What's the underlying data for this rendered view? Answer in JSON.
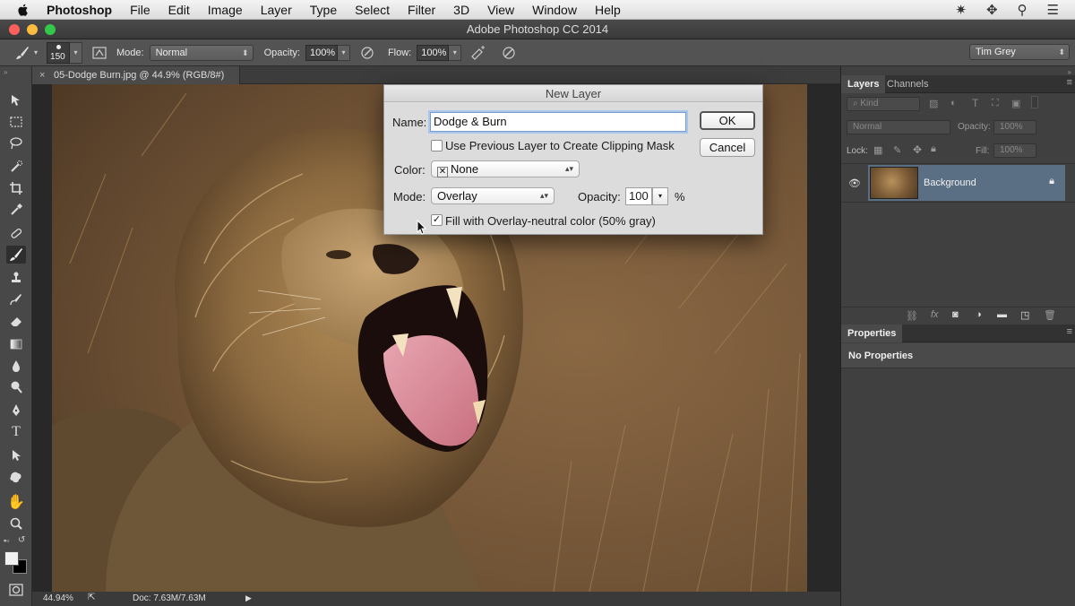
{
  "menubar": {
    "app_name": "Photoshop",
    "items": [
      "File",
      "Edit",
      "Image",
      "Layer",
      "Type",
      "Select",
      "Filter",
      "3D",
      "View",
      "Window",
      "Help"
    ]
  },
  "window": {
    "title": "Adobe Photoshop CC 2014"
  },
  "options_bar": {
    "brush_size": "150",
    "mode_label": "Mode:",
    "mode_value": "Normal",
    "opacity_label": "Opacity:",
    "opacity_value": "100%",
    "flow_label": "Flow:",
    "flow_value": "100%",
    "workspace": "Tim Grey"
  },
  "document": {
    "tab_title": "05-Dodge Burn.jpg @ 44.9% (RGB/8#)",
    "zoom": "44.94%",
    "doc_size": "Doc: 7.63M/7.63M"
  },
  "layers_panel": {
    "tabs": [
      "Layers",
      "Channels"
    ],
    "filter_kind": "Kind",
    "blend_mode": "Normal",
    "opacity_label": "Opacity:",
    "opacity_value": "100%",
    "lock_label": "Lock:",
    "fill_label": "Fill:",
    "fill_value": "100%",
    "layers": [
      {
        "name": "Background",
        "locked": true,
        "visible": true
      }
    ]
  },
  "properties_panel": {
    "tab": "Properties",
    "message": "No Properties"
  },
  "dialog": {
    "title": "New Layer",
    "name_label": "Name:",
    "name_value": "Dodge & Burn",
    "clipping_label": "Use Previous Layer to Create Clipping Mask",
    "clipping_checked": false,
    "color_label": "Color:",
    "color_value": "None",
    "mode_label": "Mode:",
    "mode_value": "Overlay",
    "opacity_label": "Opacity:",
    "opacity_value": "100",
    "opacity_unit": "%",
    "fill_neutral_label": "Fill with Overlay-neutral color (50% gray)",
    "fill_neutral_checked": true,
    "ok_label": "OK",
    "cancel_label": "Cancel"
  },
  "colors": {
    "layer_selected": "#5a6e84",
    "dialog_bg": "#dcdcdc"
  }
}
